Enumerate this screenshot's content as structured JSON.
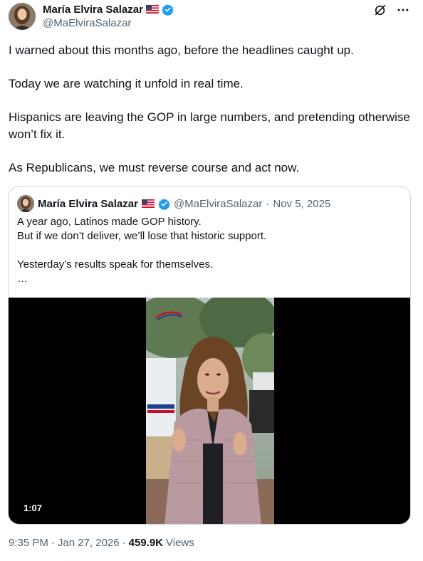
{
  "author": {
    "display_name": "María Elvira Salazar",
    "handle": "@MaElviraSalazar",
    "flag_icon": "us-flag-icon",
    "verified_color": "#1d9bf0"
  },
  "header_actions": {
    "grok_icon": "grok-icon",
    "more_icon": "more-icon"
  },
  "tweet": {
    "paragraphs": [
      "I warned about this months ago, before the headlines caught up.",
      "Today we are watching it unfold in real time.",
      "Hispanics are leaving the GOP in large numbers, and pretending otherwise won’t fix it.",
      "As Republicans, we must reverse course and act now."
    ]
  },
  "quote": {
    "display_name": "María Elvira Salazar",
    "handle": "@MaElviraSalazar",
    "separator": "·",
    "date": "Nov 5, 2025",
    "lines": [
      "A year ago, Latinos made GOP history.",
      "But if we don’t deliver, we’ll lose that historic support.",
      "",
      "Yesterday’s results speak for themselves.",
      "…"
    ],
    "video": {
      "duration": "1:07",
      "logo_text": "MARIA ELVIRA SALAZAR"
    }
  },
  "footer": {
    "time": "9:35 PM",
    "separator": "·",
    "date": "Jan 27, 2026",
    "views_count": "459.9K",
    "views_label": "Views"
  }
}
